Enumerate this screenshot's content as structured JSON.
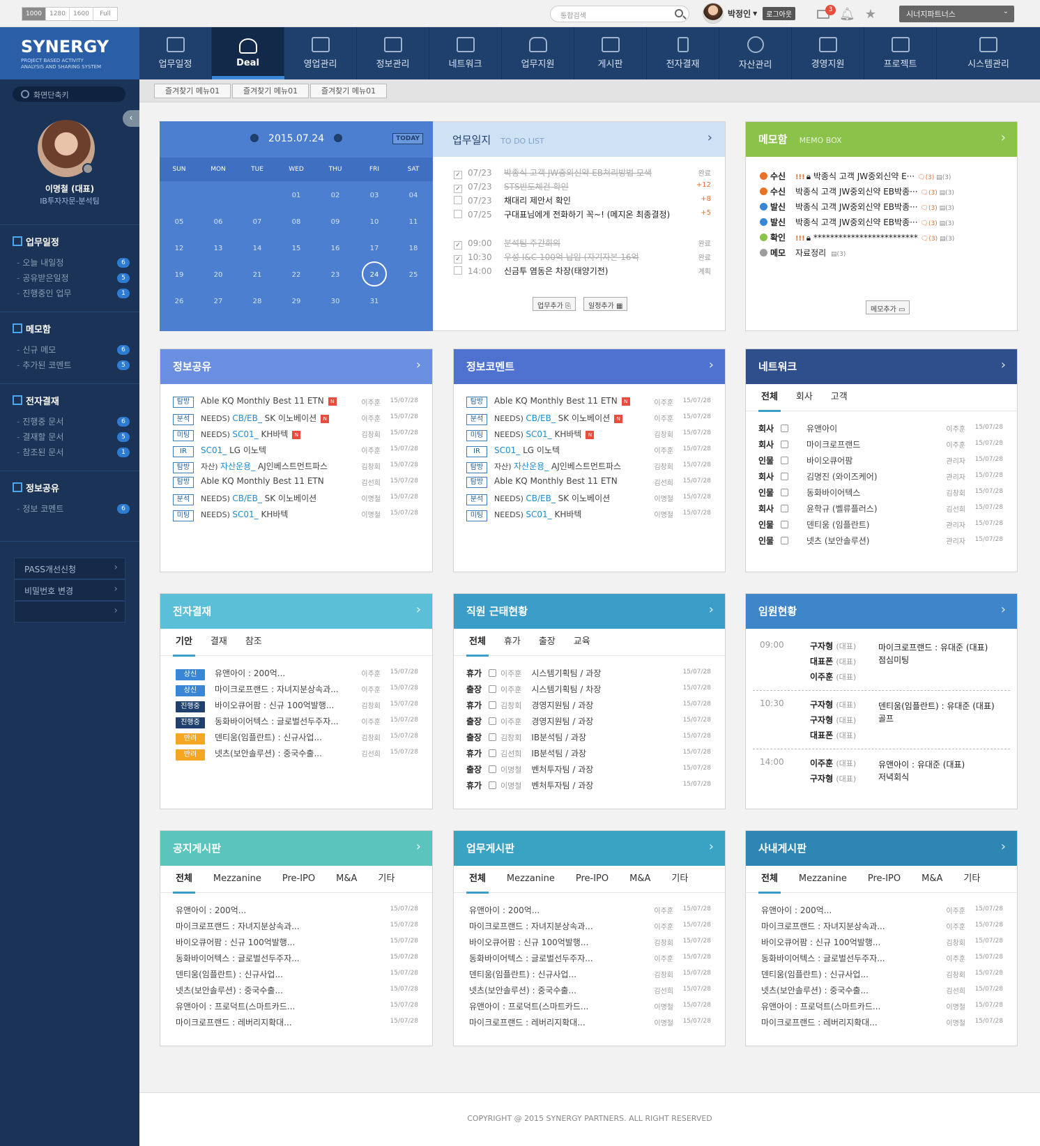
{
  "topbar": {
    "resolutions": [
      "1000",
      "1280",
      "1600",
      "Full"
    ],
    "search_placeholder": "통합검색",
    "user_name": "박정인",
    "logout": "로그아웃",
    "mail_count": "3",
    "partner_select": "시너지파트너스"
  },
  "logo": {
    "title": "SYNERGY",
    "sub1": "PROJECT BASED ACTIVITY",
    "sub2": "ANALYSIS AND SHARING SYSTEM"
  },
  "gnb": [
    "업무일정",
    "Deal",
    "영업관리",
    "정보관리",
    "네트워크",
    "업무지원",
    "게시판",
    "전자결재",
    "자산관리",
    "경영지원",
    "프로젝트",
    "시스템관리"
  ],
  "sidebar": {
    "quick_search": "화면단축키",
    "profile_name": "이명철 (대표)",
    "profile_dept": "IB투자자문-분석팀",
    "sections": [
      {
        "title": "업무일정",
        "items": [
          {
            "label": "오늘 내일정",
            "count": "6"
          },
          {
            "label": "공유받은일정",
            "count": "5"
          },
          {
            "label": "진행중인 업무",
            "count": "1"
          }
        ]
      },
      {
        "title": "메모함",
        "items": [
          {
            "label": "신규 메모",
            "count": "6"
          },
          {
            "label": "추가된 코멘트",
            "count": "5"
          }
        ]
      },
      {
        "title": "전자결재",
        "items": [
          {
            "label": "진행중 문서",
            "count": "6"
          },
          {
            "label": "결재할 문서",
            "count": "5"
          },
          {
            "label": "참조된 문서",
            "count": "1"
          }
        ]
      },
      {
        "title": "정보공유",
        "items": [
          {
            "label": "정보 코멘트",
            "count": "6"
          }
        ]
      }
    ],
    "buttons": [
      "PASS개선신청",
      "비밀번호 변경",
      ""
    ]
  },
  "favorites": [
    "즐겨찾기 메뉴01",
    "즐겨찾기 메뉴01",
    "즐겨찾기 메뉴01"
  ],
  "calendar": {
    "date": "2015.07.24",
    "today": "TODAY",
    "weekdays": [
      "SUN",
      "MON",
      "TUE",
      "WED",
      "THU",
      "FRI",
      "SAT"
    ],
    "weeks": [
      [
        "",
        "",
        "",
        "01",
        "02",
        "03",
        "04"
      ],
      [
        "05",
        "06",
        "07",
        "08",
        "09",
        "10",
        "11"
      ],
      [
        "12",
        "13",
        "14",
        "15",
        "16",
        "17",
        "18"
      ],
      [
        "19",
        "20",
        "21",
        "22",
        "23",
        "24",
        "25"
      ],
      [
        "26",
        "27",
        "28",
        "29",
        "30",
        "31",
        ""
      ]
    ],
    "selected": "24"
  },
  "todo": {
    "title": "업무일지",
    "subtitle": "TO DO LIST",
    "items": [
      {
        "time": "07/23",
        "text": "박종식 고객 JW중외신약 EB처리방법 모색",
        "status": "완료",
        "done": true
      },
      {
        "time": "07/23",
        "text": "STS반도체건 확인",
        "status": "+12",
        "done": true
      },
      {
        "time": "07/23",
        "text": "채대리 제안서 확인",
        "status": "+8",
        "done": false
      },
      {
        "time": "07/25",
        "text": "구대표님에게 전화하기 꼭~! (메지온 최종결정)",
        "status": "+5",
        "done": false
      },
      {
        "time": "09:00",
        "text": "분석팀 주간회의",
        "status": "완료",
        "done": true
      },
      {
        "time": "10:30",
        "text": "우성 I&C 100억 납입 (자기자본 16억",
        "status": "완료",
        "done": true
      },
      {
        "time": "14:00",
        "text": "신금투 염동은 차장(태양기전)",
        "status": "계획",
        "done": false
      }
    ],
    "btn_task": "업무추가",
    "btn_schedule": "일정추가"
  },
  "memo": {
    "title": "메모함",
    "subtitle": "MEMO BOX",
    "items": [
      {
        "kind": "수신",
        "color": "#e8742a",
        "text": "박종식 고객 JW중외신약 E···",
        "alert": true,
        "lock": true,
        "cmt": "(3)",
        "att": "(3)"
      },
      {
        "kind": "수신",
        "color": "#e8742a",
        "text": "박종식 고객 JW중외신약 EB박종···",
        "alert": false,
        "lock": false,
        "cmt": "(3)",
        "att": "(3)"
      },
      {
        "kind": "발신",
        "color": "#3a86d6",
        "text": "박종식 고객 JW중외신약 EB박종···",
        "alert": false,
        "lock": false,
        "cmt": "(3)",
        "att": "(3)"
      },
      {
        "kind": "발신",
        "color": "#3a86d6",
        "text": "박종식 고객 JW중외신약 EB박종···",
        "alert": false,
        "lock": false,
        "cmt": "(3)",
        "att": "(3)"
      },
      {
        "kind": "확인",
        "color": "#8bc34a",
        "text": "*************************",
        "alert": true,
        "lock": true,
        "cmt": "(3)",
        "att": "(3)"
      },
      {
        "kind": "메모",
        "color": "#9e9e9e",
        "text": "자료정리",
        "alert": false,
        "lock": false,
        "cmt": "",
        "att": "(3)"
      }
    ],
    "btn_add": "메모추가"
  },
  "info_share": {
    "title": "정보공유",
    "rows": [
      {
        "tag": "탐방",
        "pre": "",
        "link": "",
        "text": "Able KQ Monthly Best 11 ETN",
        "new": true,
        "who": "이주훈",
        "date": "15/07/28"
      },
      {
        "tag": "분석",
        "pre": "NEEDS)",
        "link": "CB/EB_",
        "text": "SK 이노베이션",
        "new": true,
        "who": "이주훈",
        "date": "15/07/28"
      },
      {
        "tag": "미팅",
        "pre": "NEEDS)",
        "link": "SC01_",
        "text": "KH바텍",
        "new": true,
        "who": "김창회",
        "date": "15/07/28"
      },
      {
        "tag": "IR",
        "pre": "",
        "link": "SC01_",
        "text": "LG 이노텍",
        "new": false,
        "who": "이주훈",
        "date": "15/07/28"
      },
      {
        "tag": "탐방",
        "pre": "자산)",
        "link": "자산운용_",
        "text": "AJ인베스트먼트파스",
        "new": false,
        "who": "김창회",
        "date": "15/07/28"
      },
      {
        "tag": "탐방",
        "pre": "",
        "link": "",
        "text": "Able KQ Monthly Best 11 ETN",
        "new": false,
        "who": "김선희",
        "date": "15/07/28"
      },
      {
        "tag": "분석",
        "pre": "NEEDS)",
        "link": "CB/EB_",
        "text": "SK 이노베이션",
        "new": false,
        "who": "이명철",
        "date": "15/07/28"
      },
      {
        "tag": "미팅",
        "pre": "NEEDS)",
        "link": "SC01_",
        "text": "KH바텍",
        "new": false,
        "who": "이명철",
        "date": "15/07/28"
      }
    ]
  },
  "info_comment": {
    "title": "정보코멘트",
    "rows": [
      {
        "tag": "탐방",
        "pre": "",
        "link": "",
        "text": "Able KQ Monthly Best 11 ETN",
        "new": true,
        "who": "이주훈",
        "date": "15/07/28"
      },
      {
        "tag": "분석",
        "pre": "NEEDS)",
        "link": "CB/EB_",
        "text": "SK 이노베이션",
        "new": true,
        "who": "이주훈",
        "date": "15/07/28"
      },
      {
        "tag": "미팅",
        "pre": "NEEDS)",
        "link": "SC01_",
        "text": "KH바텍",
        "new": true,
        "who": "김창회",
        "date": "15/07/28"
      },
      {
        "tag": "IR",
        "pre": "",
        "link": "SC01_",
        "text": "LG 이노텍",
        "new": false,
        "who": "이주훈",
        "date": "15/07/28"
      },
      {
        "tag": "탐방",
        "pre": "자산)",
        "link": "자산운용_",
        "text": "AJ인베스트먼트파스",
        "new": false,
        "who": "김창회",
        "date": "15/07/28"
      },
      {
        "tag": "탐방",
        "pre": "",
        "link": "",
        "text": "Able KQ Monthly Best 11 ETN",
        "new": false,
        "who": "김선희",
        "date": "15/07/28"
      },
      {
        "tag": "분석",
        "pre": "NEEDS)",
        "link": "CB/EB_",
        "text": "SK 이노베이션",
        "new": false,
        "who": "이명철",
        "date": "15/07/28"
      },
      {
        "tag": "미팅",
        "pre": "NEEDS)",
        "link": "SC01_",
        "text": "KH바텍",
        "new": false,
        "who": "이명철",
        "date": "15/07/28"
      }
    ]
  },
  "network": {
    "title": "네트워크",
    "tabs": [
      "전체",
      "회사",
      "고객"
    ],
    "rows": [
      {
        "kind": "회사",
        "text": "유앤아이",
        "who": "이주훈",
        "date": "15/07/28"
      },
      {
        "kind": "회사",
        "text": "마이크로프랜드",
        "who": "이주훈",
        "date": "15/07/28"
      },
      {
        "kind": "인물",
        "text": "바이오큐어팜",
        "who": "관리자",
        "date": "15/07/28"
      },
      {
        "kind": "회사",
        "text": "김명진 (와이즈케어)",
        "who": "관리자",
        "date": "15/07/28"
      },
      {
        "kind": "인물",
        "text": "동화바이어텍스",
        "who": "김창회",
        "date": "15/07/28"
      },
      {
        "kind": "회사",
        "text": "윤학규 (벨류플러스)",
        "who": "김선희",
        "date": "15/07/28"
      },
      {
        "kind": "인물",
        "text": "덴티움 (임플란트)",
        "who": "관리자",
        "date": "15/07/28"
      },
      {
        "kind": "인물",
        "text": "넷츠 (보안솔루션)",
        "who": "관리자",
        "date": "15/07/28"
      }
    ]
  },
  "approval": {
    "title": "전자결재",
    "tabs": [
      "기안",
      "결재",
      "참조"
    ],
    "rows": [
      {
        "tag": "상신",
        "color": "#3a86d6",
        "text": "유앤아이 : 200억...",
        "who": "이주훈",
        "date": "15/07/28"
      },
      {
        "tag": "상신",
        "color": "#3a86d6",
        "text": "마이크로프랜드 : 자녀지분상속과...",
        "who": "이주훈",
        "date": "15/07/28"
      },
      {
        "tag": "진행중",
        "color": "#1f3f6c",
        "text": "바이오큐어팜 : 신규 100억발행...",
        "who": "김창회",
        "date": "15/07/28"
      },
      {
        "tag": "진행중",
        "color": "#1f3f6c",
        "text": "동화바이어텍스 : 글로벌선두주자...",
        "who": "이주훈",
        "date": "15/07/28"
      },
      {
        "tag": "반려",
        "color": "#f5a623",
        "text": "덴티움(임플란트) : 신규사업...",
        "who": "김창회",
        "date": "15/07/28"
      },
      {
        "tag": "반려",
        "color": "#f5a623",
        "text": "넷츠(보안솔루션) : 중국수출...",
        "who": "김선희",
        "date": "15/07/28"
      }
    ]
  },
  "attendance": {
    "title": "직원 근태현황",
    "tabs": [
      "전체",
      "휴가",
      "출장",
      "교육"
    ],
    "rows": [
      {
        "kind": "휴가",
        "name": "이주훈",
        "text": "시스템기획팀 / 과장",
        "date": "15/07/28"
      },
      {
        "kind": "출장",
        "name": "이주훈",
        "text": "시스템기획팀 / 차장",
        "date": "15/07/28"
      },
      {
        "kind": "휴가",
        "name": "김창회",
        "text": "경영지원팀 / 과장",
        "date": "15/07/28"
      },
      {
        "kind": "출장",
        "name": "이주훈",
        "text": "경영지원팀 / 과장",
        "date": "15/07/28"
      },
      {
        "kind": "출장",
        "name": "김창회",
        "text": "IB분석팀 / 과장",
        "date": "15/07/28"
      },
      {
        "kind": "휴가",
        "name": "김선희",
        "text": "IB분석팀 / 과장",
        "date": "15/07/28"
      },
      {
        "kind": "출장",
        "name": "이명철",
        "text": "벤처투자팀 / 과장",
        "date": "15/07/28"
      },
      {
        "kind": "휴가",
        "name": "이명철",
        "text": "벤처투자팀 / 과장",
        "date": "15/07/28"
      }
    ]
  },
  "executives": {
    "title": "임원현황",
    "blocks": [
      {
        "time": "09:00",
        "people": [
          {
            "n": "구자형",
            "r": "(대표)"
          },
          {
            "n": "대표폰",
            "r": "(대표)"
          },
          {
            "n": "이주훈",
            "r": "(대표)"
          }
        ],
        "desc": [
          "마이크로프랜드 : 유대준 (대표)",
          "점심미팅"
        ]
      },
      {
        "time": "10:30",
        "people": [
          {
            "n": "구자형",
            "r": "(대표)"
          },
          {
            "n": "구자형",
            "r": "(대표)"
          },
          {
            "n": "대표폰",
            "r": "(대표)"
          }
        ],
        "desc": [
          "덴티움(임플란트) : 유대준 (대표)",
          "골프"
        ]
      },
      {
        "time": "14:00",
        "people": [
          {
            "n": "이주훈",
            "r": "(대표)"
          },
          {
            "n": "구자형",
            "r": "(대표)"
          }
        ],
        "desc": [
          "유앤아이 : 유대준 (대표)",
          "저녁회식"
        ]
      }
    ]
  },
  "boards": [
    {
      "title": "공지게시판",
      "color": "#5bc5bd",
      "tabs": [
        "전체",
        "Mezzanine",
        "Pre-IPO",
        "M&A",
        "기타"
      ],
      "rows": [
        {
          "text": "유앤아이 : 200억...",
          "who": "",
          "date": "15/07/28"
        },
        {
          "text": "마이크로프랜드 : 자녀지분상속과...",
          "who": "",
          "date": "15/07/28"
        },
        {
          "text": "바이오큐어팜 : 신규 100억발행...",
          "who": "",
          "date": "15/07/28"
        },
        {
          "text": "동화바이어텍스 : 글로벌선두주자...",
          "who": "",
          "date": "15/07/28"
        },
        {
          "text": "덴티움(임플란트) : 신규사업...",
          "who": "",
          "date": "15/07/28"
        },
        {
          "text": "넷츠(보안솔루션) : 중국수출...",
          "who": "",
          "date": "15/07/28"
        },
        {
          "text": "유앤아이 : 프로덕트(스마트카드...",
          "who": "",
          "date": "15/07/28"
        },
        {
          "text": "마이크로프랜드 : 레버리지확대...",
          "who": "",
          "date": "15/07/28"
        }
      ]
    },
    {
      "title": "업무게시판",
      "color": "#3aa3c4",
      "tabs": [
        "전체",
        "Mezzanine",
        "Pre-IPO",
        "M&A",
        "기타"
      ],
      "rows": [
        {
          "text": "유앤아이 : 200억...",
          "who": "이주훈",
          "date": "15/07/28"
        },
        {
          "text": "마이크로프랜드 : 자녀지분상속과...",
          "who": "이주훈",
          "date": "15/07/28"
        },
        {
          "text": "바이오큐어팜 : 신규 100억발행...",
          "who": "김창회",
          "date": "15/07/28"
        },
        {
          "text": "동화바이어텍스 : 글로벌선두주자...",
          "who": "이주훈",
          "date": "15/07/28"
        },
        {
          "text": "덴티움(임플란트) : 신규사업...",
          "who": "김창회",
          "date": "15/07/28"
        },
        {
          "text": "넷츠(보안솔루션) : 중국수출...",
          "who": "김선희",
          "date": "15/07/28"
        },
        {
          "text": "유앤아이 : 프로덕트(스마트카드...",
          "who": "이명철",
          "date": "15/07/28"
        },
        {
          "text": "마이크로프랜드 : 레버리지확대...",
          "who": "이명철",
          "date": "15/07/28"
        }
      ]
    },
    {
      "title": "사내게시판",
      "color": "#2e87b3",
      "tabs": [
        "전체",
        "Mezzanine",
        "Pre-IPO",
        "M&A",
        "기타"
      ],
      "rows": [
        {
          "text": "유앤아이 : 200억...",
          "who": "이주훈",
          "date": "15/07/28"
        },
        {
          "text": "마이크로프랜드 : 자녀지분상속과...",
          "who": "이주훈",
          "date": "15/07/28"
        },
        {
          "text": "바이오큐어팜 : 신규 100억발행...",
          "who": "김창회",
          "date": "15/07/28"
        },
        {
          "text": "동화바이어텍스 : 글로벌선두주자...",
          "who": "이주훈",
          "date": "15/07/28"
        },
        {
          "text": "덴티움(임플란트) : 신규사업...",
          "who": "김창회",
          "date": "15/07/28"
        },
        {
          "text": "넷츠(보안솔루션) : 중국수출...",
          "who": "김선희",
          "date": "15/07/28"
        },
        {
          "text": "유앤아이 : 프로덕트(스마트카드...",
          "who": "이명철",
          "date": "15/07/28"
        },
        {
          "text": "마이크로프랜드 : 레버리지확대...",
          "who": "이명철",
          "date": "15/07/28"
        }
      ]
    }
  ],
  "colors": {
    "info_share": "#6a8fe0",
    "info_comment": "#4f72d0",
    "network": "#2e4f8c",
    "approval": "#5cbfd8",
    "attendance": "#3a9ec9",
    "executives": "#3e86c9",
    "memo": "#8bc34a"
  },
  "footer": "COPYRIGHT @ 2015 SYNERGY PARTNERS. ALL RIGHT RESERVED"
}
